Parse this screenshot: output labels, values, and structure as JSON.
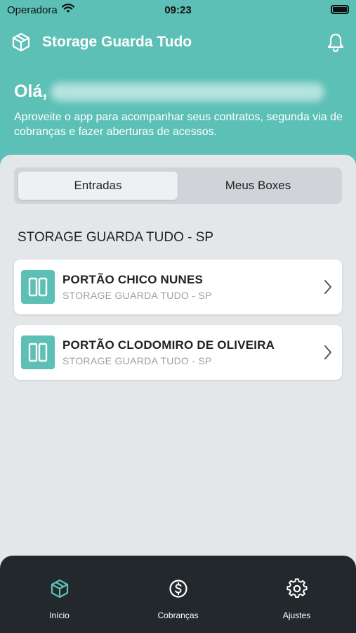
{
  "status_bar": {
    "carrier": "Operadora",
    "time": "09:23"
  },
  "app_bar": {
    "title": "Storage Guarda Tudo",
    "logo_icon": "box-icon",
    "notification_icon": "bell-icon"
  },
  "greeting": {
    "hello": "Olá,",
    "message": "Aproveite o app para acompanhar seus contratos, segunda via de cobranças e fazer aberturas de acessos."
  },
  "segmented": {
    "tabs": [
      {
        "label": "Entradas",
        "active": true
      },
      {
        "label": "Meus Boxes",
        "active": false
      }
    ]
  },
  "section": {
    "title": "STORAGE GUARDA TUDO - SP"
  },
  "gates": [
    {
      "title": "PORTÃO CHICO NUNES",
      "subtitle": "STORAGE GUARDA TUDO - SP"
    },
    {
      "title": "PORTÃO CLODOMIRO DE OLIVEIRA",
      "subtitle": "STORAGE GUARDA TUDO - SP"
    }
  ],
  "tabbar": {
    "items": [
      {
        "label": "Início",
        "icon": "box-icon",
        "active": true
      },
      {
        "label": "Cobranças",
        "icon": "dollar-circle-icon",
        "active": false
      },
      {
        "label": "Ajustes",
        "icon": "gear-icon",
        "active": false
      }
    ]
  },
  "colors": {
    "accent": "#5cc0b6",
    "tabbar_bg": "#23282c",
    "background": "#e4e7ea"
  }
}
